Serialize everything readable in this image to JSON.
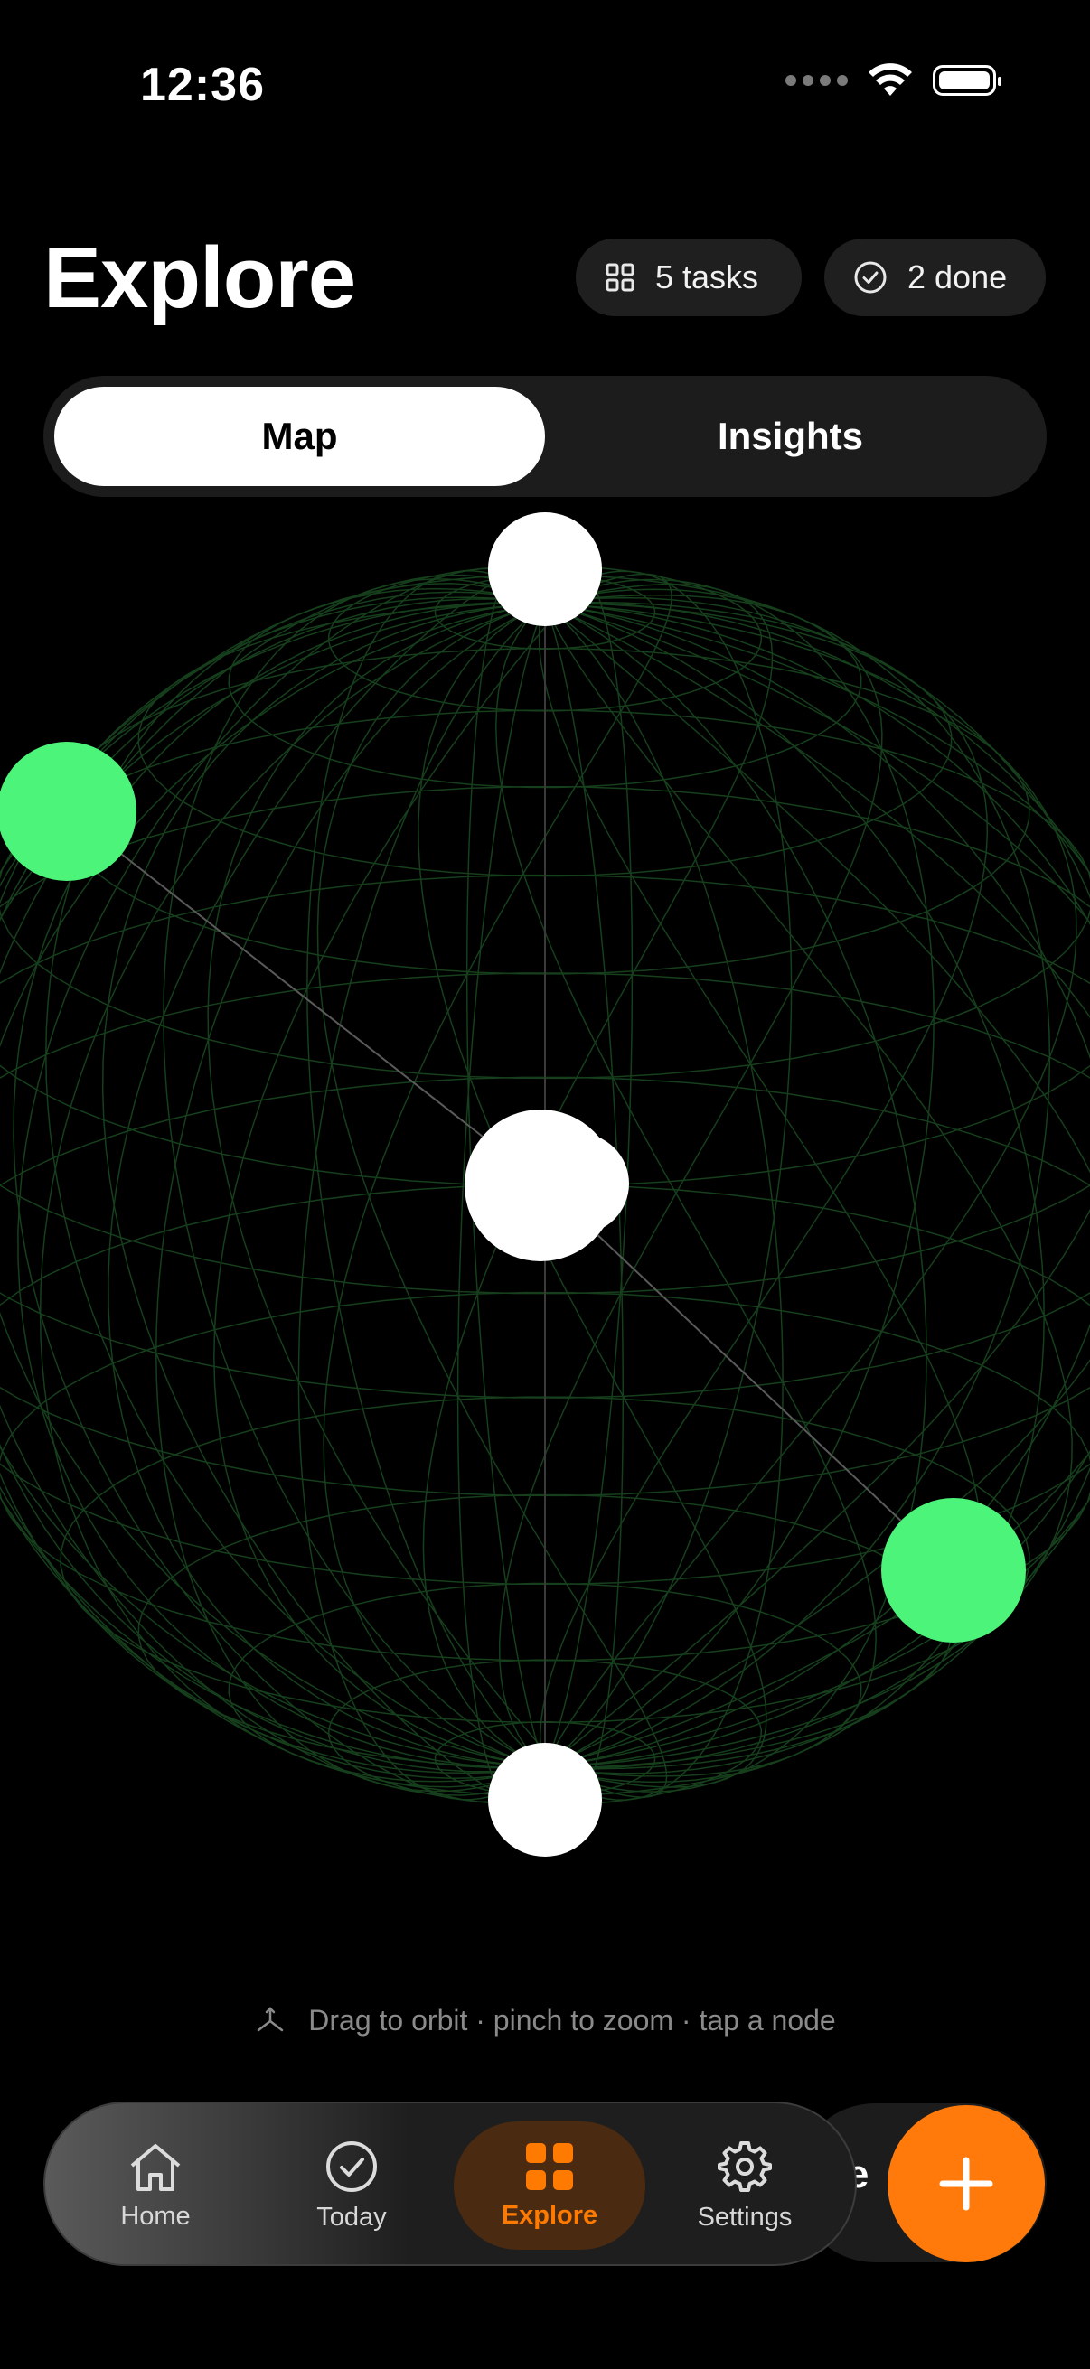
{
  "status_bar": {
    "time": "12:36",
    "icons": [
      "signal-icon",
      "wifi-icon",
      "battery-icon"
    ]
  },
  "header": {
    "title": "Explore",
    "tasks_badge": "5 tasks",
    "done_badge": "2 done"
  },
  "segmented": {
    "options": [
      "Map",
      "Insights"
    ],
    "selected": "Map"
  },
  "graph": {
    "nodes": [
      {
        "id": "top",
        "status": "open"
      },
      {
        "id": "left",
        "status": "done"
      },
      {
        "id": "center",
        "status": "open"
      },
      {
        "id": "right",
        "status": "done"
      },
      {
        "id": "bottom",
        "status": "open"
      }
    ],
    "colors": {
      "open": "#ffffff",
      "done": "#4cf57a",
      "mesh": "#1f4a26"
    }
  },
  "hint": {
    "text": "Drag to orbit · pinch to zoom · tap a node"
  },
  "tabbar": {
    "items": [
      {
        "label": "Home",
        "icon": "home-icon"
      },
      {
        "label": "Today",
        "icon": "check-circle-icon"
      },
      {
        "label": "Explore",
        "icon": "grid-icon"
      },
      {
        "label": "Settings",
        "icon": "gear-icon"
      }
    ],
    "selected": "Explore",
    "partial_text": "pe"
  },
  "fab": {
    "icon": "plus-icon",
    "color": "#ff7a0a"
  },
  "accent_color": "#ff7a00"
}
